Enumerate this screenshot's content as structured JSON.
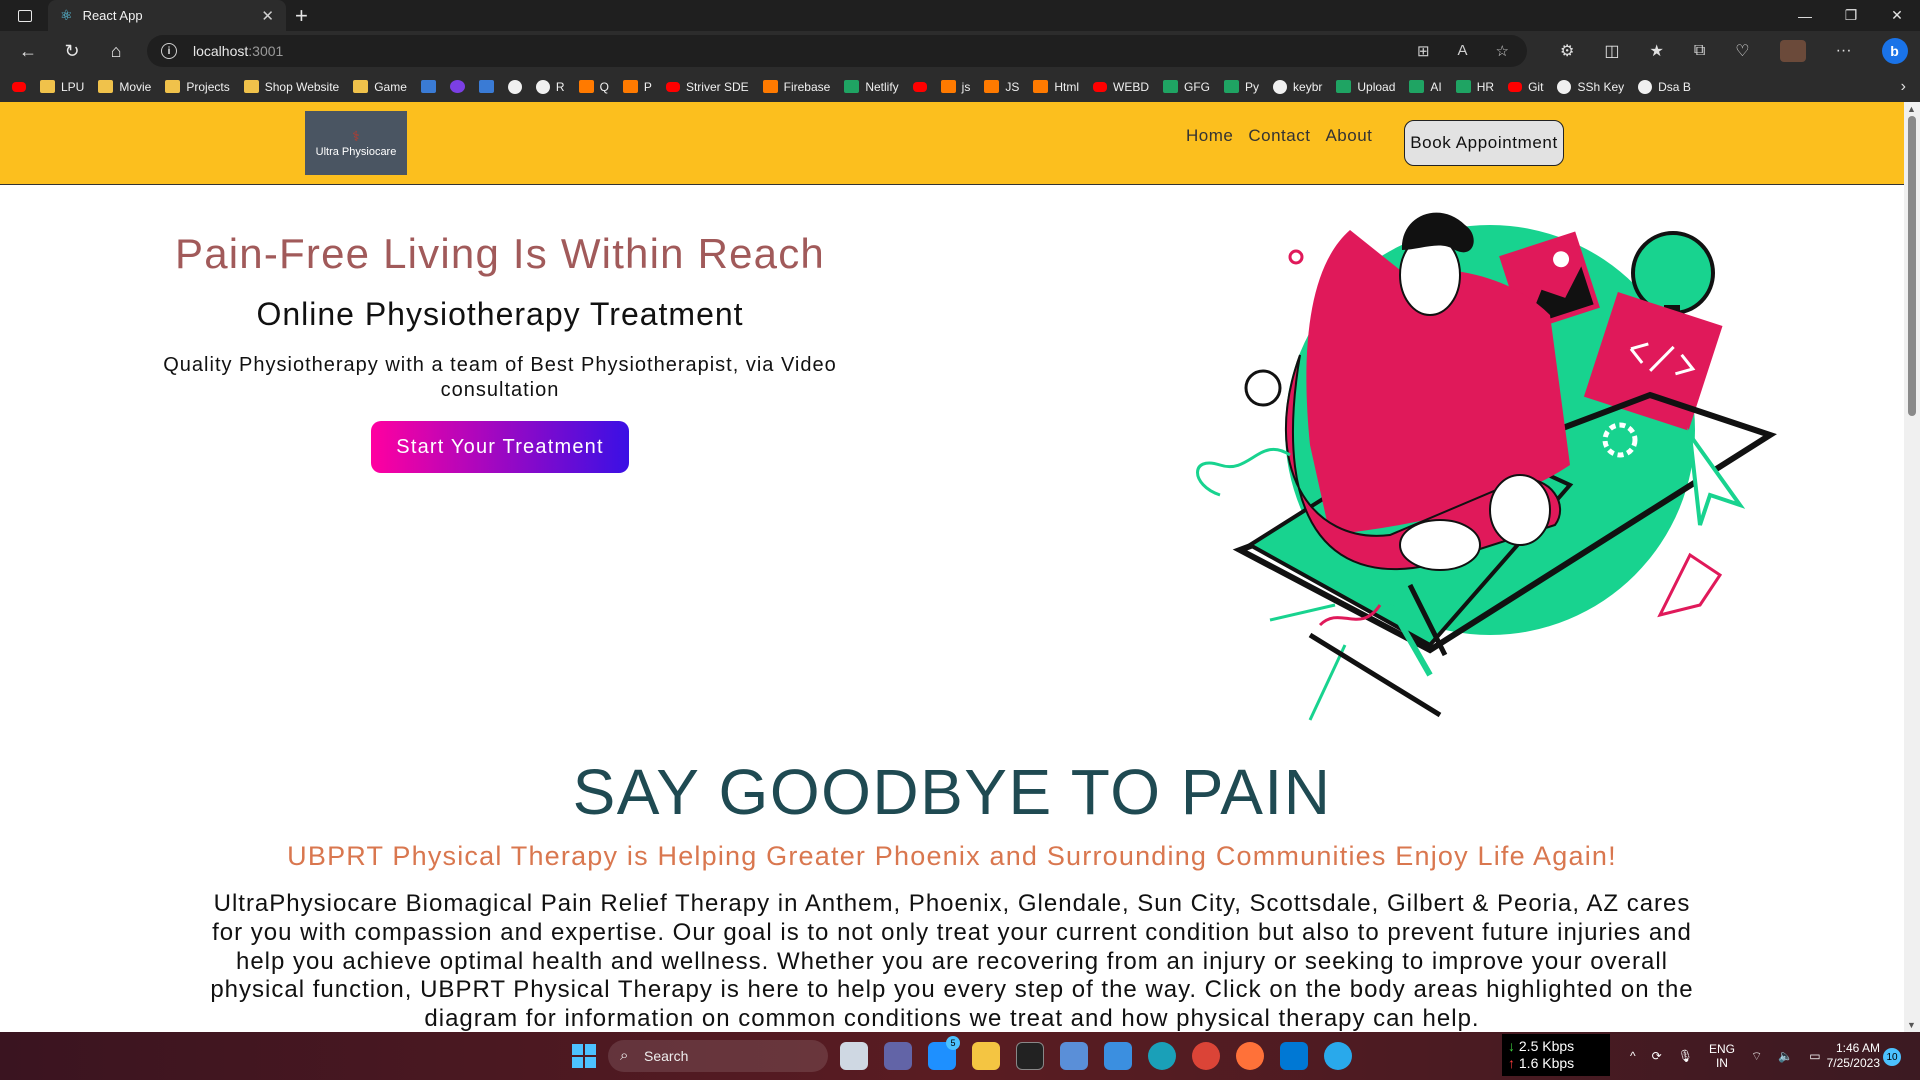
{
  "browser": {
    "tab_title": "React App",
    "url_host": "localhost",
    "url_port": ":3001",
    "bookmarks": [
      {
        "label": "",
        "icon": "gmail-icon"
      },
      {
        "label": "LPU",
        "icon": "folder-icon"
      },
      {
        "label": "Movie",
        "icon": "folder-icon"
      },
      {
        "label": "Projects",
        "icon": "folder-icon"
      },
      {
        "label": "Shop Website",
        "icon": "folder-icon"
      },
      {
        "label": "Game",
        "icon": "folder-icon"
      },
      {
        "label": "",
        "icon": "linkedin-icon"
      },
      {
        "label": "",
        "icon": "app-icon"
      },
      {
        "label": "",
        "icon": "outlook-icon"
      },
      {
        "label": "",
        "icon": "github-icon"
      },
      {
        "label": "R",
        "icon": "github-icon"
      },
      {
        "label": "Q",
        "icon": "leetcode-icon"
      },
      {
        "label": "P",
        "icon": "leetcode-icon"
      },
      {
        "label": "Striver SDE",
        "icon": "pdf-icon"
      },
      {
        "label": "Firebase",
        "icon": "firebase-icon"
      },
      {
        "label": "Netlify",
        "icon": "netlify-icon"
      },
      {
        "label": "",
        "icon": "youtube-icon"
      },
      {
        "label": "js",
        "icon": "code-icon"
      },
      {
        "label": "JS",
        "icon": "code-icon"
      },
      {
        "label": "Html",
        "icon": "code-icon"
      },
      {
        "label": "WEBD",
        "icon": "youtube-icon"
      },
      {
        "label": "GFG",
        "icon": "gfg-icon"
      },
      {
        "label": "Py",
        "icon": "hackerrank-icon"
      },
      {
        "label": "keybr",
        "icon": "keybr-icon"
      },
      {
        "label": "Upload",
        "icon": "cloud-icon"
      },
      {
        "label": "AI",
        "icon": "ai-icon"
      },
      {
        "label": "HR",
        "icon": "hackerrank-icon"
      },
      {
        "label": "Git",
        "icon": "youtube-icon"
      },
      {
        "label": "SSh Key",
        "icon": "github-icon"
      },
      {
        "label": "Dsa B",
        "icon": "github-icon"
      }
    ]
  },
  "site": {
    "logo_text": "Ultra Physiocare",
    "nav": [
      "Home",
      "Contact",
      "About"
    ],
    "book_button": "Book Appointment",
    "hero": {
      "title": "Pain-Free Living Is Within Reach",
      "subtitle": "Online Physiotherapy Treatment",
      "description": "Quality Physiotherapy with a team of Best Physiotherapist, via Video consultation",
      "cta": "Start Your Treatment"
    },
    "section2": {
      "title": "SAY GOODBYE TO PAIN",
      "tagline": "UBPRT Physical Therapy is Helping Greater Phoenix and Surrounding Communities Enjoy Life Again!",
      "body": "UltraPhysiocare Biomagical Pain Relief Therapy in Anthem, Phoenix, Glendale, Sun City, Scottsdale, Gilbert & Peoria, AZ cares for you with compassion and expertise. Our goal is to not only treat your current condition but also to prevent future injuries and help you achieve optimal health and wellness. Whether you are recovering from an injury or seeking to improve your overall physical function, UBPRT Physical Therapy is here to help you every step of the way. Click on the body areas highlighted on the diagram for information on common conditions we treat and how physical therapy can help."
    },
    "colors": {
      "header_bg": "#fcbf1e",
      "hero_title": "#a15a5a",
      "section_title": "#1f4a52",
      "tagline": "#d9774f",
      "cta_gradient_start": "#ff00a0",
      "cta_gradient_end": "#3a10e5"
    }
  },
  "taskbar": {
    "search_placeholder": "Search",
    "mail_badge": "5",
    "net_down": "2.5 Kbps",
    "net_up": "1.6 Kbps",
    "lang_top": "ENG",
    "lang_bottom": "IN",
    "time": "1:46 AM",
    "date": "7/25/2023",
    "notifications": "10"
  }
}
